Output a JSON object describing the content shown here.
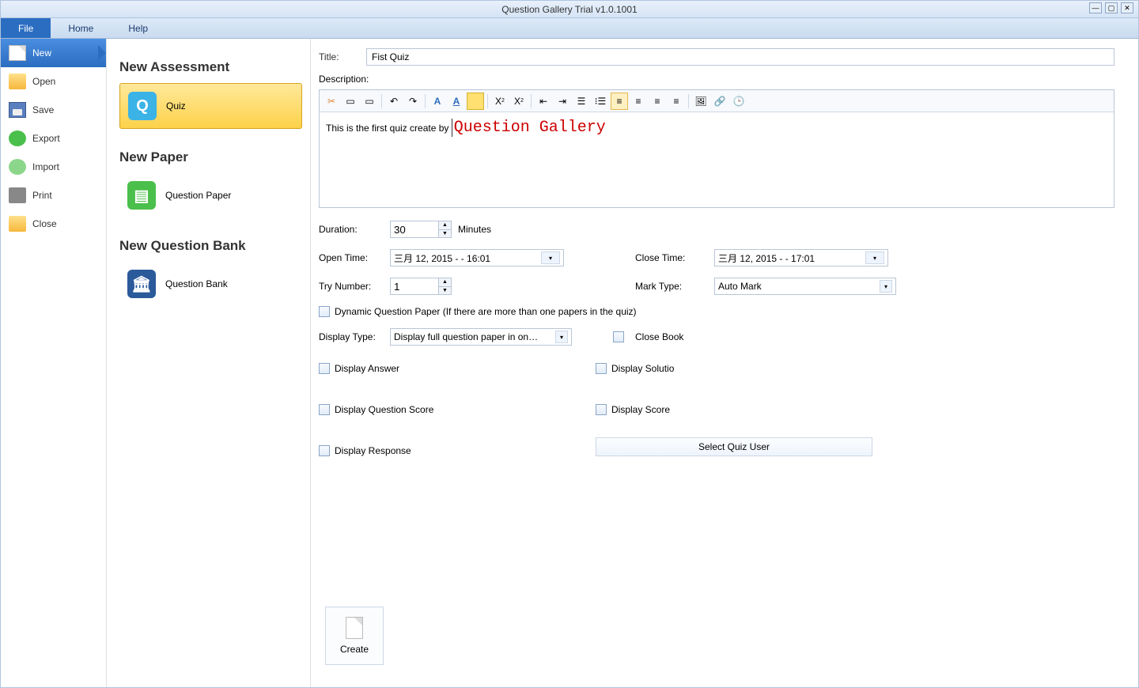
{
  "window": {
    "title": "Question Gallery Trial   v1.0.1001"
  },
  "menubar": {
    "file": "File",
    "home": "Home",
    "help": "Help"
  },
  "sidebar_left": {
    "new": "New",
    "open": "Open",
    "save": "Save",
    "export": "Export",
    "import": "Import",
    "print": "Print",
    "close": "Close"
  },
  "sidebar_mid": {
    "new_assessment_header": "New Assessment",
    "quiz": "Quiz",
    "new_paper_header": "New Paper",
    "question_paper": "Question Paper",
    "new_bank_header": "New Question Bank",
    "question_bank": "Question Bank"
  },
  "form": {
    "title_label": "Title:",
    "title_value": "Fist Quiz",
    "description_label": "Description:",
    "rte_text_before": "This is the first quiz create by ",
    "rte_text_highlight": "Question Gallery",
    "duration_label": "Duration:",
    "duration_value": "30",
    "duration_unit": "Minutes",
    "open_time_label": "Open Time:",
    "open_time_value": "三月  12, 2015 - - 16:01",
    "close_time_label": "Close Time:",
    "close_time_value": "三月  12, 2015 - - 17:01",
    "try_number_label": "Try Number:",
    "try_number_value": "1",
    "mark_type_label": "Mark Type:",
    "mark_type_value": "Auto Mark",
    "dynamic_qp_label": "Dynamic Question Paper (If there are more than one papers in the quiz)",
    "display_type_label": "Display Type:",
    "display_type_value": "Display full question paper in on…",
    "close_book_label": "Close Book",
    "display_answer_label": "Display Answer",
    "display_solution_label": "Display Solutio",
    "display_question_score_label": "Display Question Score",
    "display_score_label": "Display Score",
    "display_response_label": "Display Response",
    "select_quiz_user_btn": "Select Quiz User",
    "create_btn": "Create"
  },
  "toolbar_icons": {
    "paste": "paste-icon",
    "copy_format": "copy-format-icon",
    "clear_format": "clear-format-icon",
    "undo": "undo-icon",
    "redo": "redo-icon",
    "font_color": "font-color-icon",
    "font_bg": "font-bg-icon",
    "highlight": "highlight-icon",
    "subscript": "subscript-icon",
    "superscript": "superscript-icon",
    "indent": "indent-icon",
    "outdent": "outdent-icon",
    "ordered_list": "ordered-list-icon",
    "unordered_list": "unordered-list-icon",
    "align_left": "align-left-icon",
    "align_center": "align-center-icon",
    "align_right": "align-right-icon",
    "align_justify": "align-justify-icon",
    "image": "image-icon",
    "link": "link-icon",
    "clock": "clock-icon"
  }
}
